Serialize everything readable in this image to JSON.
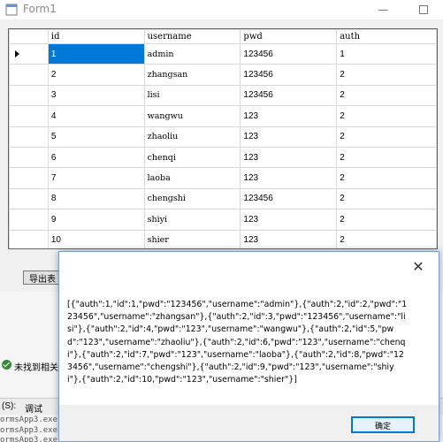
{
  "window": {
    "title": "Form1"
  },
  "grid": {
    "columns": [
      "id",
      "username",
      "pwd",
      "auth"
    ],
    "rows": [
      [
        "1",
        "admin",
        "123456",
        "1"
      ],
      [
        "2",
        "zhangsan",
        "123456",
        "2"
      ],
      [
        "3",
        "lisi",
        "123456",
        "2"
      ],
      [
        "4",
        "wangwu",
        "123",
        "2"
      ],
      [
        "5",
        "zhaoliu",
        "123",
        "2"
      ],
      [
        "6",
        "chenqi",
        "123",
        "2"
      ],
      [
        "7",
        "laoba",
        "123",
        "2"
      ],
      [
        "8",
        "chengshi",
        "123456",
        "2"
      ],
      [
        "9",
        "shiyi",
        "123",
        "2"
      ],
      [
        "10",
        "shier",
        "123",
        "2"
      ]
    ],
    "selected_row": 0
  },
  "form": {
    "export_label": "导出表"
  },
  "background": {
    "status_text": "未找到相关",
    "panel_s": "(S):",
    "panel_tab": "调试",
    "output_lines": [
      "ormsApp3.exe",
      "ormsApp3.exe",
      "ormsApp3.exe"
    ]
  },
  "msgbox": {
    "close_glyph": "✕",
    "message": "[{\"auth\":1,\"id\":1,\"pwd\":\"123456\",\"username\":\"admin\"},{\"auth\":2,\"id\":2,\"pwd\":\"123456\",\"username\":\"zhangsan\"},{\"auth\":2,\"id\":3,\"pwd\":\"123456\",\"username\":\"lisi\"},{\"auth\":2,\"id\":4,\"pwd\":\"123\",\"username\":\"wangwu\"},{\"auth\":2,\"id\":5,\"pwd\":\"123\",\"username\":\"zhaoliu\"},{\"auth\":2,\"id\":6,\"pwd\":\"123\",\"username\":\"chenqi\"},{\"auth\":2,\"id\":7,\"pwd\":\"123\",\"username\":\"laoba\"},{\"auth\":2,\"id\":8,\"pwd\":\"123456\",\"username\":\"chengshi\"},{\"auth\":2,\"id\":9,\"pwd\":\"123\",\"username\":\"shiyi\"},{\"auth\":2,\"id\":10,\"pwd\":\"123\",\"username\":\"shier\"}]",
    "ok_label": "确定"
  },
  "colors": {
    "selection": "#0078d7",
    "grid_background": "#a0a0a0"
  }
}
